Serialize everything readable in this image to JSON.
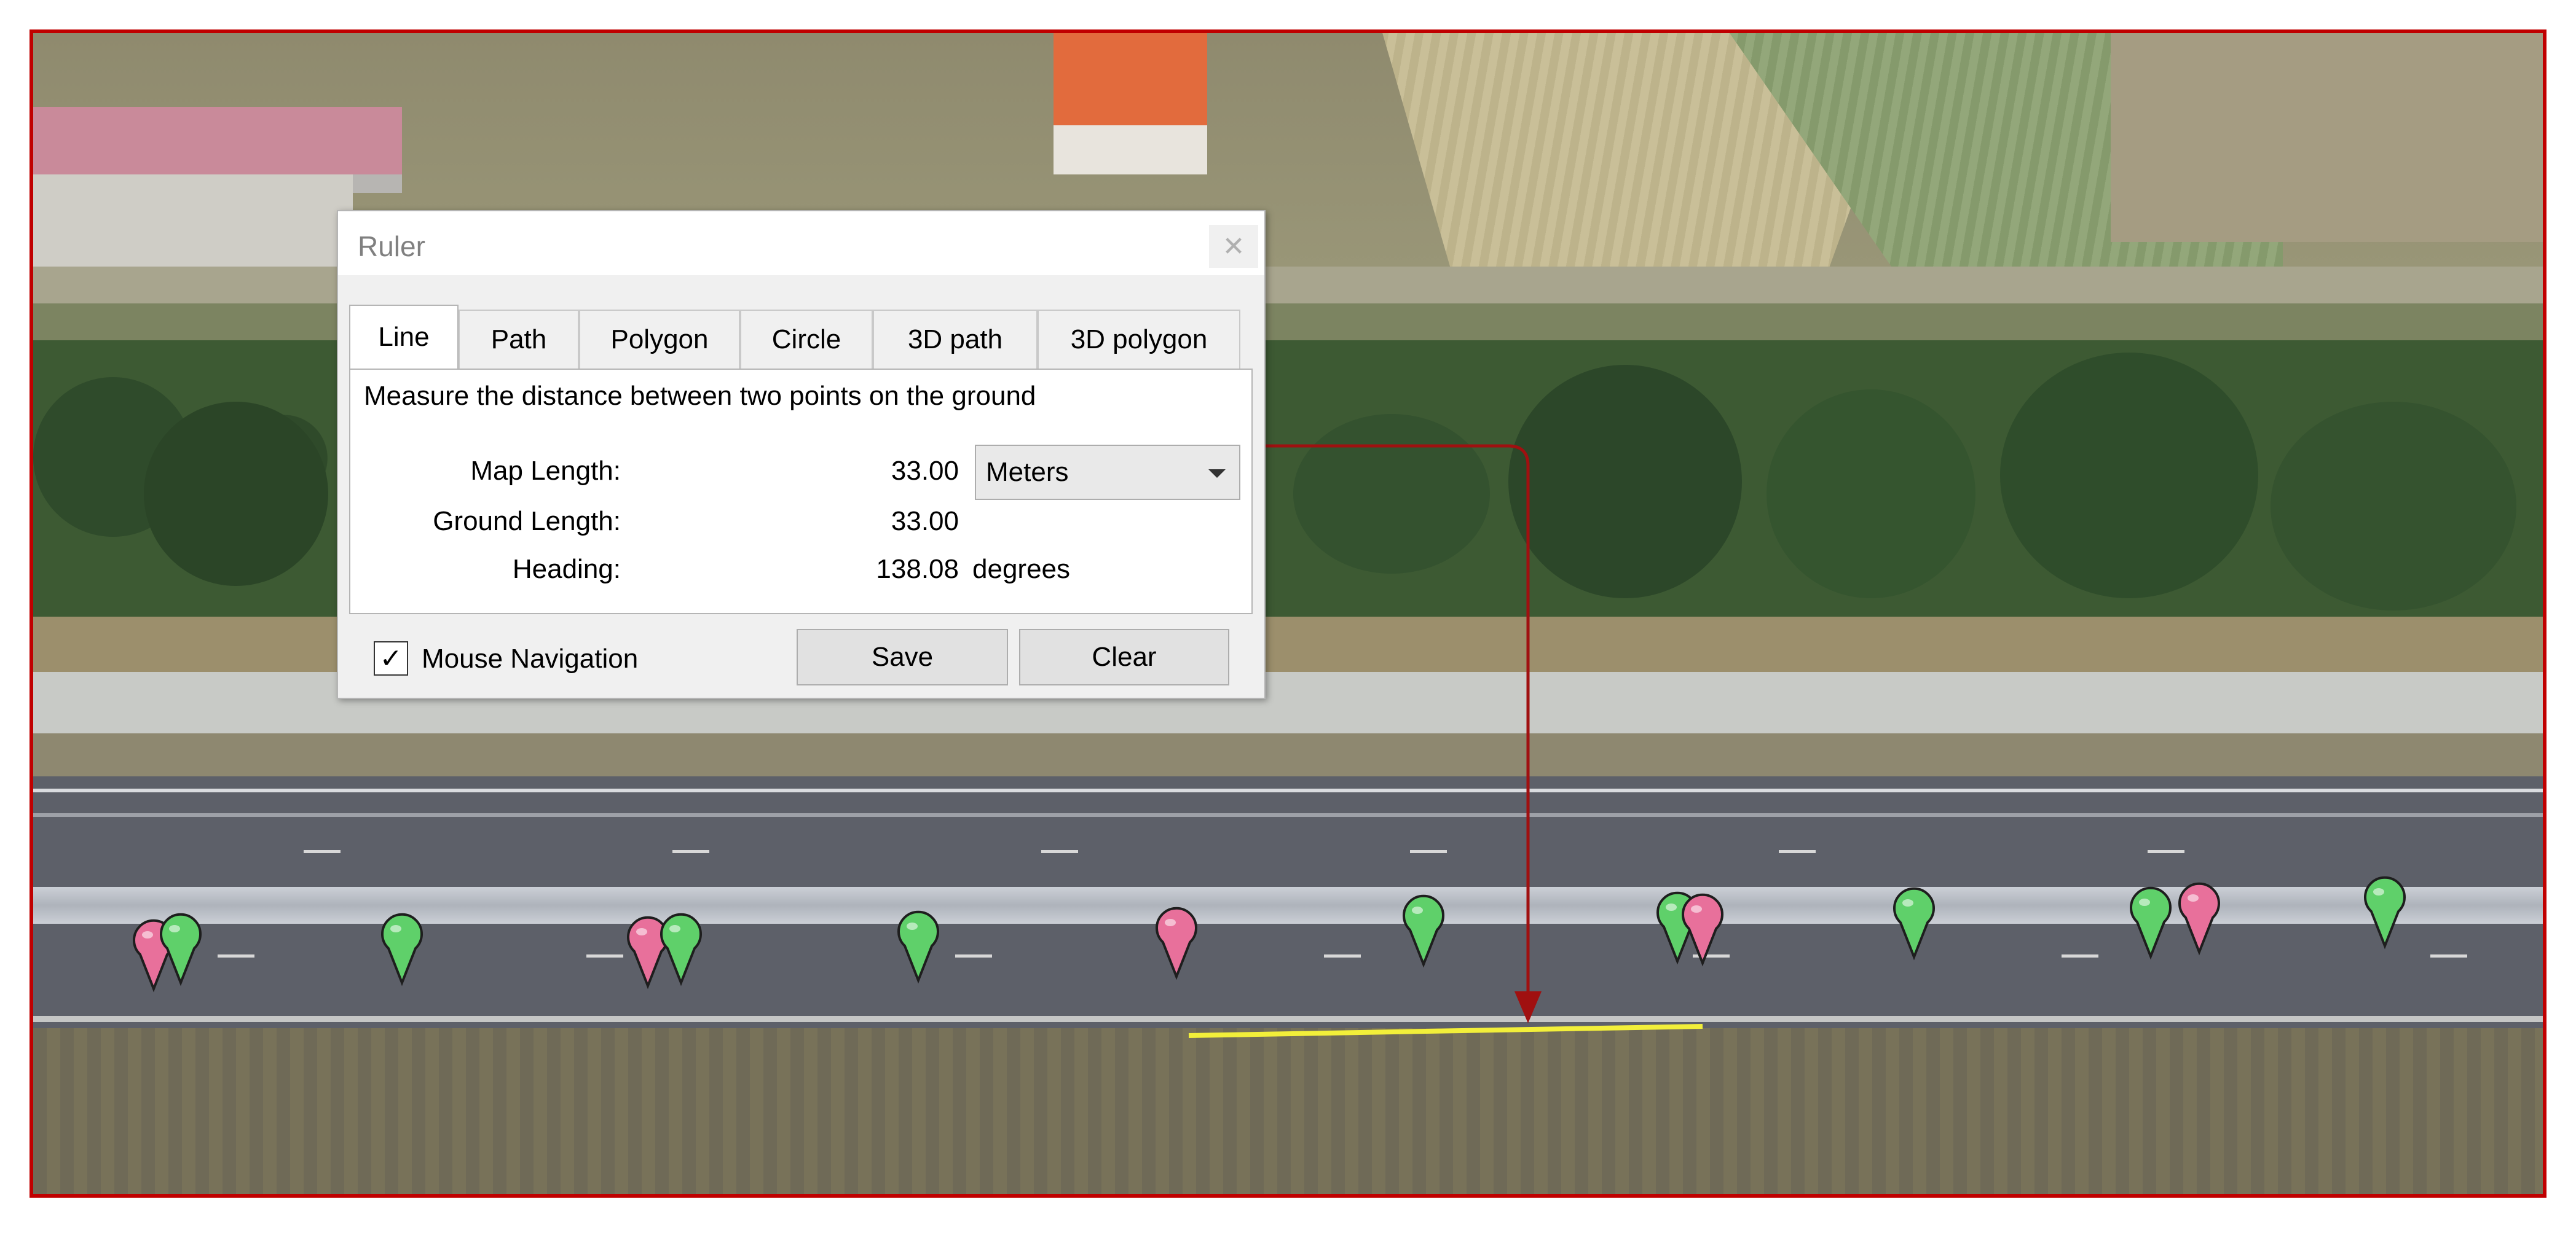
{
  "dialog": {
    "title": "Ruler",
    "close_symbol": "✕",
    "tabs": [
      {
        "label": "Line",
        "active": true
      },
      {
        "label": "Path",
        "active": false
      },
      {
        "label": "Polygon",
        "active": false
      },
      {
        "label": "Circle",
        "active": false
      },
      {
        "label": "3D path",
        "active": false
      },
      {
        "label": "3D polygon",
        "active": false
      }
    ],
    "description": "Measure the distance between two points on the ground",
    "map_length_label": "Map Length:",
    "map_length_value": "33.00",
    "units": {
      "selected": "Meters"
    },
    "ground_length_label": "Ground Length:",
    "ground_length_value": "33.00",
    "heading_label": "Heading:",
    "heading_value": "138.08",
    "heading_unit": "degrees",
    "mouse_navigation": {
      "label": "Mouse Navigation",
      "checked": true,
      "check_symbol": "✓"
    },
    "save_label": "Save",
    "clear_label": "Clear"
  },
  "markers": [
    {
      "color": "pink"
    },
    {
      "color": "green"
    },
    {
      "color": "green"
    },
    {
      "color": "pink"
    },
    {
      "color": "green"
    },
    {
      "color": "green"
    },
    {
      "color": "pink"
    },
    {
      "color": "green"
    },
    {
      "color": "green"
    },
    {
      "color": "pink"
    },
    {
      "color": "green"
    },
    {
      "color": "green"
    },
    {
      "color": "pink"
    },
    {
      "color": "green"
    }
  ],
  "colors": {
    "frame_border": "#c00000",
    "measure_line": "#f2ef3a",
    "callout_arrow": "#a01010",
    "marker_pink": "#e8709b",
    "marker_green": "#5fd06a"
  }
}
